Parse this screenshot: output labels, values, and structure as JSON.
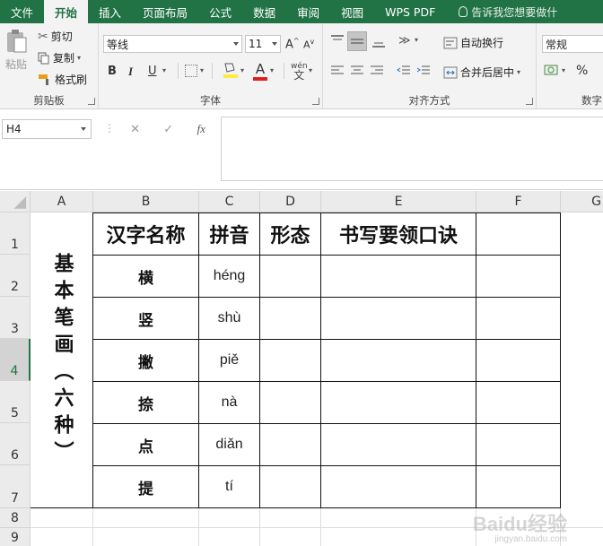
{
  "menu": {
    "items": [
      "文件",
      "开始",
      "插入",
      "页面布局",
      "公式",
      "数据",
      "审阅",
      "视图",
      "WPS PDF"
    ],
    "active_index": 1,
    "tell_me": "告诉我您想要做什"
  },
  "ribbon": {
    "clipboard": {
      "paste": "粘贴",
      "cut": "剪切",
      "copy": "复制",
      "format_painter": "格式刷",
      "label": "剪贴板"
    },
    "font": {
      "name": "等线",
      "size": "11",
      "bold": "B",
      "italic": "I",
      "underline": "U",
      "label": "字体",
      "phonetic": "wén"
    },
    "alignment": {
      "wrap_text": "自动换行",
      "merge_center": "合并后居中",
      "label": "对齐方式"
    },
    "number": {
      "format": "常规",
      "percent": "%",
      "label": "数字"
    }
  },
  "formula_bar": {
    "name_box": "H4",
    "formula": ""
  },
  "sheet": {
    "columns": [
      "A",
      "B",
      "C",
      "D",
      "E",
      "F",
      "G"
    ],
    "rows": [
      "1",
      "2",
      "3",
      "4",
      "5",
      "6",
      "7",
      "8",
      "9"
    ],
    "selected_row": "4",
    "title_vertical": "基本笔画（六种）",
    "headers": [
      "汉字名称",
      "拼音",
      "形态",
      "书写要领口诀"
    ],
    "strokes": [
      {
        "name": "横",
        "pinyin": "héng"
      },
      {
        "name": "竖",
        "pinyin": "shù"
      },
      {
        "name": "撇",
        "pinyin": "piě"
      },
      {
        "name": "捺",
        "pinyin": "nà"
      },
      {
        "name": "点",
        "pinyin": "diǎn"
      },
      {
        "name": "提",
        "pinyin": "tí"
      }
    ]
  },
  "watermark": {
    "main": "Baidu经验",
    "sub": "jingyan.baidu.com"
  }
}
